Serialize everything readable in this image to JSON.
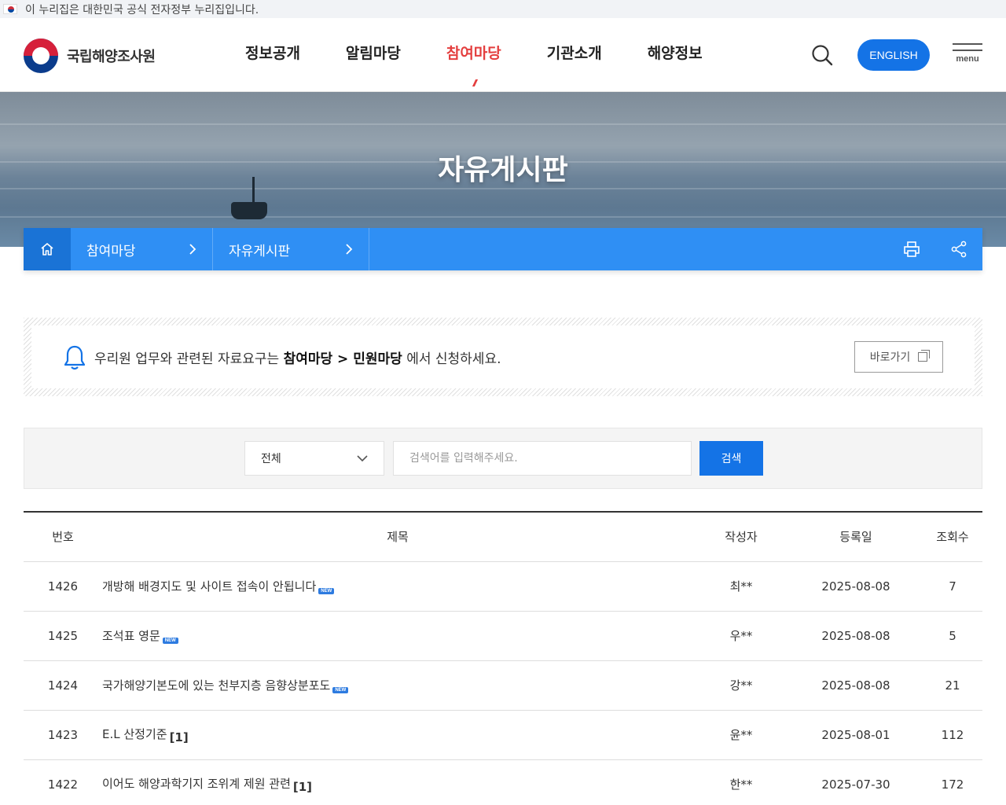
{
  "gov_banner": {
    "text": "이 누리집은 대한민국 공식 전자정부 누리집입니다."
  },
  "header": {
    "logo_text": "국립해양조사원",
    "nav": [
      {
        "label": "정보공개",
        "active": false
      },
      {
        "label": "알림마당",
        "active": false
      },
      {
        "label": "참여마당",
        "active": true
      },
      {
        "label": "기관소개",
        "active": false
      },
      {
        "label": "해양정보",
        "active": false
      }
    ],
    "english_label": "ENGLISH",
    "menu_label": "menu"
  },
  "hero": {
    "title": "자유게시판"
  },
  "location": {
    "segments": [
      "참여마당",
      "자유게시판"
    ]
  },
  "notice": {
    "prefix": "우리원 업무와 관련된 자료요구는 ",
    "path_a": "참여마당",
    "path_sep": " > ",
    "path_b": "민원마당",
    "suffix": " 에서 신청하세요.",
    "goto_label": "바로가기"
  },
  "search": {
    "select_value": "전체",
    "input_value": "",
    "placeholder": "검색어를 입력해주세요.",
    "button_label": "검색"
  },
  "table": {
    "headers": [
      "번호",
      "제목",
      "작성자",
      "등록일",
      "조회수"
    ],
    "rows": [
      {
        "no": "1426",
        "title": "개방해 배경지도 및 사이트 접속이 안됩니다",
        "new": true,
        "comments": "",
        "writer": "최**",
        "date": "2025-08-08",
        "views": "7"
      },
      {
        "no": "1425",
        "title": "조석표 영문",
        "new": true,
        "comments": "",
        "writer": "우**",
        "date": "2025-08-08",
        "views": "5"
      },
      {
        "no": "1424",
        "title": "국가해양기본도에 있는 천부지층 음향상분포도",
        "new": true,
        "comments": "",
        "writer": "강**",
        "date": "2025-08-08",
        "views": "21"
      },
      {
        "no": "1423",
        "title": "E.L 산정기준",
        "new": false,
        "comments": "[1]",
        "writer": "윤**",
        "date": "2025-08-01",
        "views": "112"
      },
      {
        "no": "1422",
        "title": "이어도 해양과학기지 조위계 제원 관련",
        "new": false,
        "comments": "[1]",
        "writer": "한**",
        "date": "2025-07-30",
        "views": "172"
      }
    ],
    "new_badge_text": "NEW"
  },
  "colors": {
    "accent": "#1473e6",
    "locbar": "#2f8ff4",
    "active_nav": "#e43f3f"
  }
}
